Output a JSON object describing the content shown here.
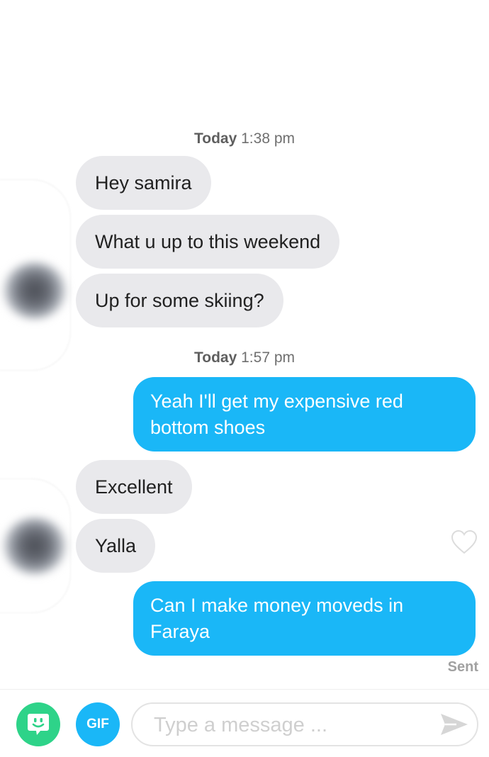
{
  "conversation": {
    "groups": [
      {
        "timestamp_day": "Today",
        "timestamp_time": "1:38 pm"
      },
      {
        "timestamp_day": "Today",
        "timestamp_time": "1:57 pm"
      }
    ],
    "messages": [
      {
        "from": "them",
        "text": "Hey samira"
      },
      {
        "from": "them",
        "text": "What u up to this weekend"
      },
      {
        "from": "them",
        "text": "Up for some skiing?"
      },
      {
        "from": "me",
        "text": "Yeah I'll get my expensive red bottom shoes"
      },
      {
        "from": "them",
        "text": "Excellent"
      },
      {
        "from": "them",
        "text": "Yalla"
      },
      {
        "from": "me",
        "text": "Can I make money moveds in Faraya"
      }
    ],
    "delivery_status": "Sent"
  },
  "composer": {
    "gif_label": "GIF",
    "placeholder": "Type a message ...",
    "sticker_icon": "sticker-face-icon",
    "send_icon": "send-arrow-icon"
  },
  "colors": {
    "sent_bubble": "#1ab7f7",
    "received_bubble": "#e9e9ec",
    "sticker_button": "#2ed389"
  }
}
